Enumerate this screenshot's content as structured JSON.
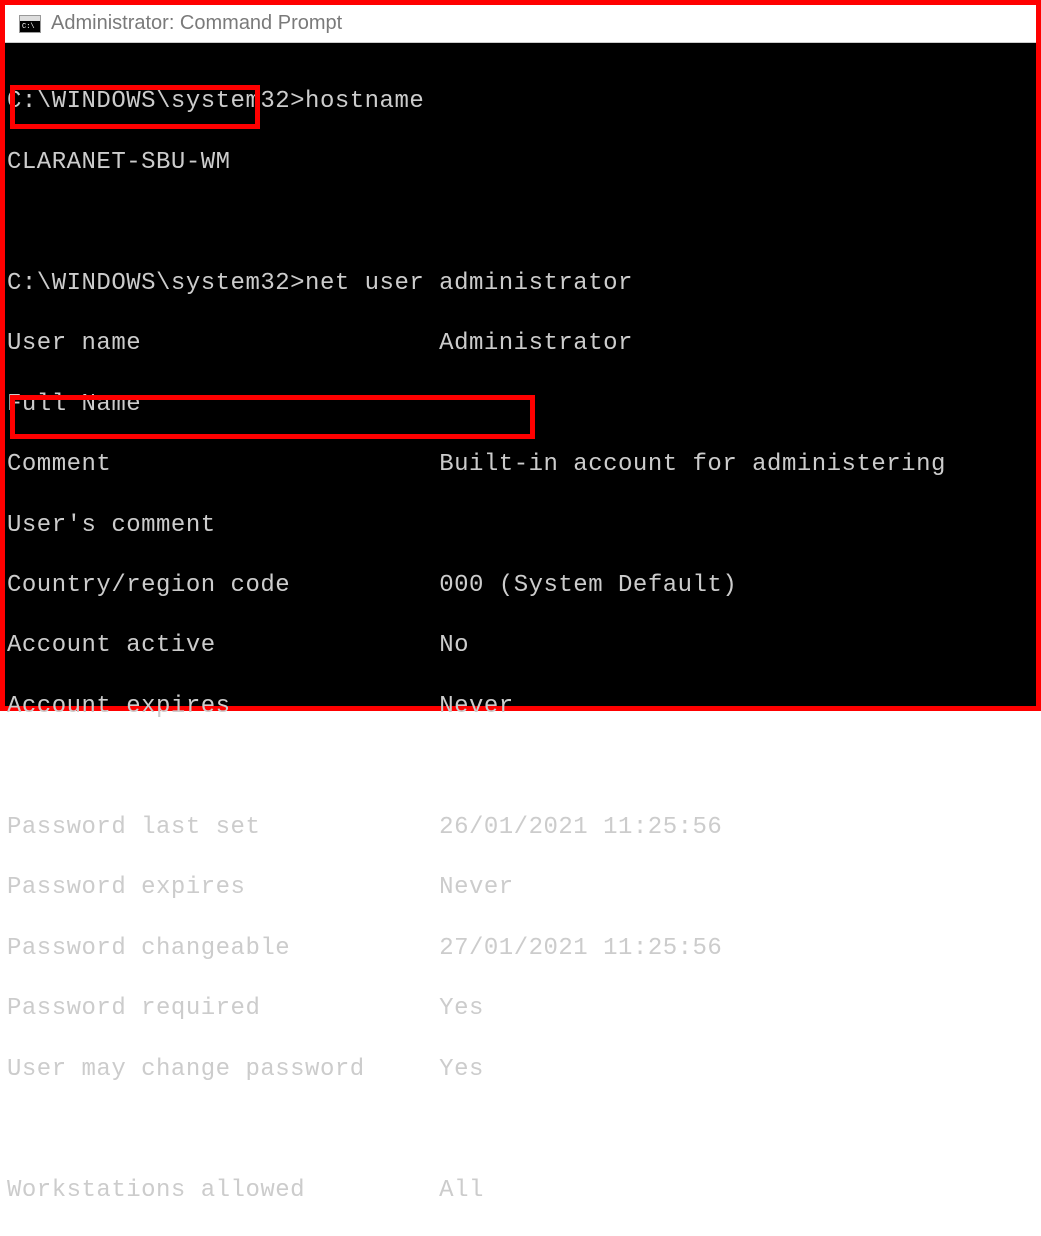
{
  "window": {
    "title": "Administrator: Command Prompt"
  },
  "terminal": {
    "prompt1": "C:\\WINDOWS\\system32>",
    "cmd1": "hostname",
    "hostname_output": "CLARANET-SBU-WM",
    "prompt2": "C:\\WINDOWS\\system32>",
    "cmd2": "net user administrator",
    "rows": [
      {
        "label": "User name",
        "value": "Administrator"
      },
      {
        "label": "Full Name",
        "value": ""
      },
      {
        "label": "Comment",
        "value": "Built-in account for administering"
      },
      {
        "label": "User's comment",
        "value": ""
      },
      {
        "label": "Country/region code",
        "value": "000 (System Default)"
      },
      {
        "label": "Account active",
        "value": "No"
      },
      {
        "label": "Account expires",
        "value": "Never"
      },
      {
        "label": "",
        "value": ""
      },
      {
        "label": "Password last set",
        "value": "26/01/2021 11:25:56"
      },
      {
        "label": "Password expires",
        "value": "Never"
      },
      {
        "label": "Password changeable",
        "value": "27/01/2021 11:25:56"
      },
      {
        "label": "Password required",
        "value": "Yes"
      },
      {
        "label": "User may change password",
        "value": "Yes"
      },
      {
        "label": "",
        "value": ""
      },
      {
        "label": "Workstations allowed",
        "value": "All"
      }
    ]
  }
}
